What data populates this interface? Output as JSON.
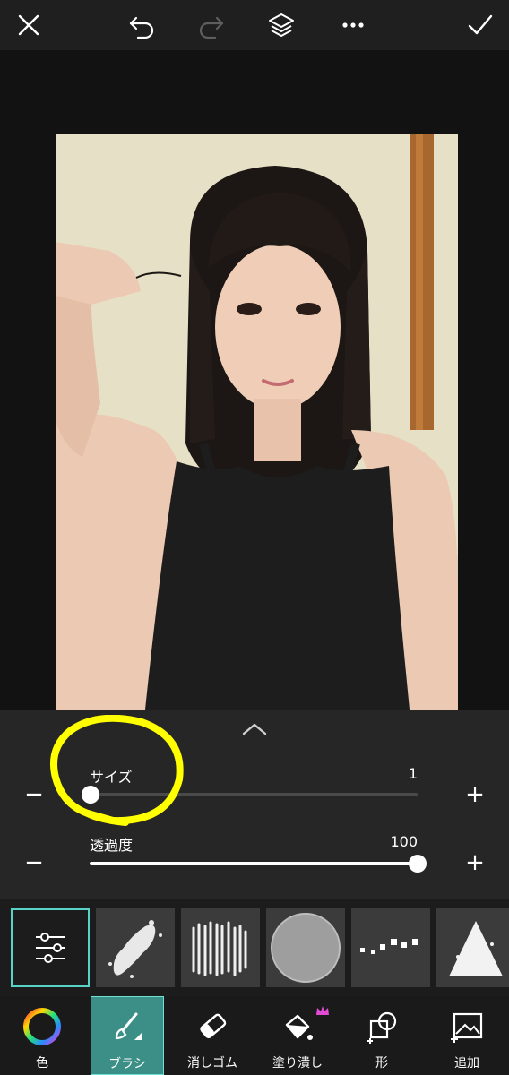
{
  "topbar": {
    "icons": [
      "close-icon",
      "undo-icon",
      "redo-icon",
      "layers-icon",
      "more-icon",
      "check-icon"
    ]
  },
  "panel": {
    "size_slider": {
      "label": "サイズ",
      "value": "1",
      "level": 0.0
    },
    "opacity_slider": {
      "label": "透過度",
      "value": "100",
      "level": 1.0
    },
    "minus_label": "−",
    "plus_label": "+"
  },
  "presets": [
    "settings",
    "brush-splatter",
    "brush-scratch",
    "brush-noise-circle",
    "brush-squares",
    "brush-triangle-spray"
  ],
  "tools": [
    {
      "label": "色",
      "icon": "color-wheel-icon"
    },
    {
      "label": "ブラシ",
      "icon": "brush-icon",
      "active": true
    },
    {
      "label": "消しゴム",
      "icon": "eraser-icon"
    },
    {
      "label": "塗り潰し",
      "icon": "fill-bucket-icon",
      "premium": true
    },
    {
      "label": "形",
      "icon": "shape-icon"
    },
    {
      "label": "追加",
      "icon": "add-image-icon"
    }
  ],
  "colors": {
    "accent": "#59d3c7",
    "active_tool_bg": "#3b8f86",
    "annotation": "#ffff00",
    "premium_crown": "#e34bd6"
  }
}
